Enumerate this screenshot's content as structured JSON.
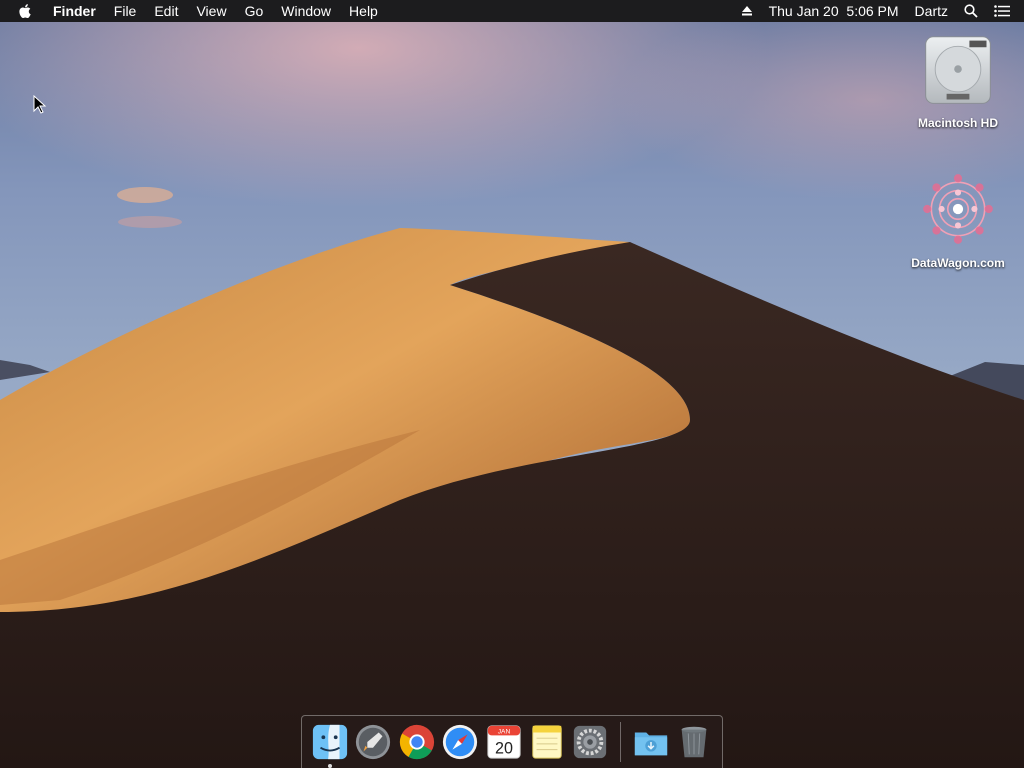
{
  "menubar": {
    "app_name": "Finder",
    "items": [
      "File",
      "Edit",
      "View",
      "Go",
      "Window",
      "Help"
    ],
    "status": {
      "eject_icon": "eject-icon",
      "datetime": "Thu Jan 20  5:06 PM",
      "user": "Dartz",
      "search_icon": "spotlight-search-icon",
      "notifications_icon": "notification-center-icon"
    }
  },
  "desktop": {
    "wallpaper": "Mojave desert dune",
    "icons": [
      {
        "label": "Macintosh HD",
        "icon": "hard-drive-icon"
      },
      {
        "label": "DataWagon.com",
        "icon": "mandala-icon"
      }
    ]
  },
  "dock": {
    "apps": [
      {
        "name": "Finder",
        "icon": "finder-icon",
        "running": true
      },
      {
        "name": "Launchpad",
        "icon": "launchpad-icon",
        "running": false
      },
      {
        "name": "Google Chrome",
        "icon": "chrome-icon",
        "running": false
      },
      {
        "name": "Safari",
        "icon": "safari-icon",
        "running": false
      },
      {
        "name": "Calendar",
        "icon": "calendar-icon",
        "running": false,
        "month": "JAN",
        "day": "20"
      },
      {
        "name": "Notes",
        "icon": "notes-icon",
        "running": false
      },
      {
        "name": "System Preferences",
        "icon": "system-preferences-icon",
        "running": false
      }
    ],
    "extras": [
      {
        "name": "Downloads",
        "icon": "downloads-folder-icon"
      },
      {
        "name": "Trash",
        "icon": "trash-icon"
      }
    ]
  },
  "colors": {
    "menubar_bg": "#1c1c1e",
    "sky_top": "#5b6e95",
    "sky_bottom": "#8fa3c2",
    "dune_light": "#d9964a",
    "dune_dark": "#2e1f1a"
  }
}
